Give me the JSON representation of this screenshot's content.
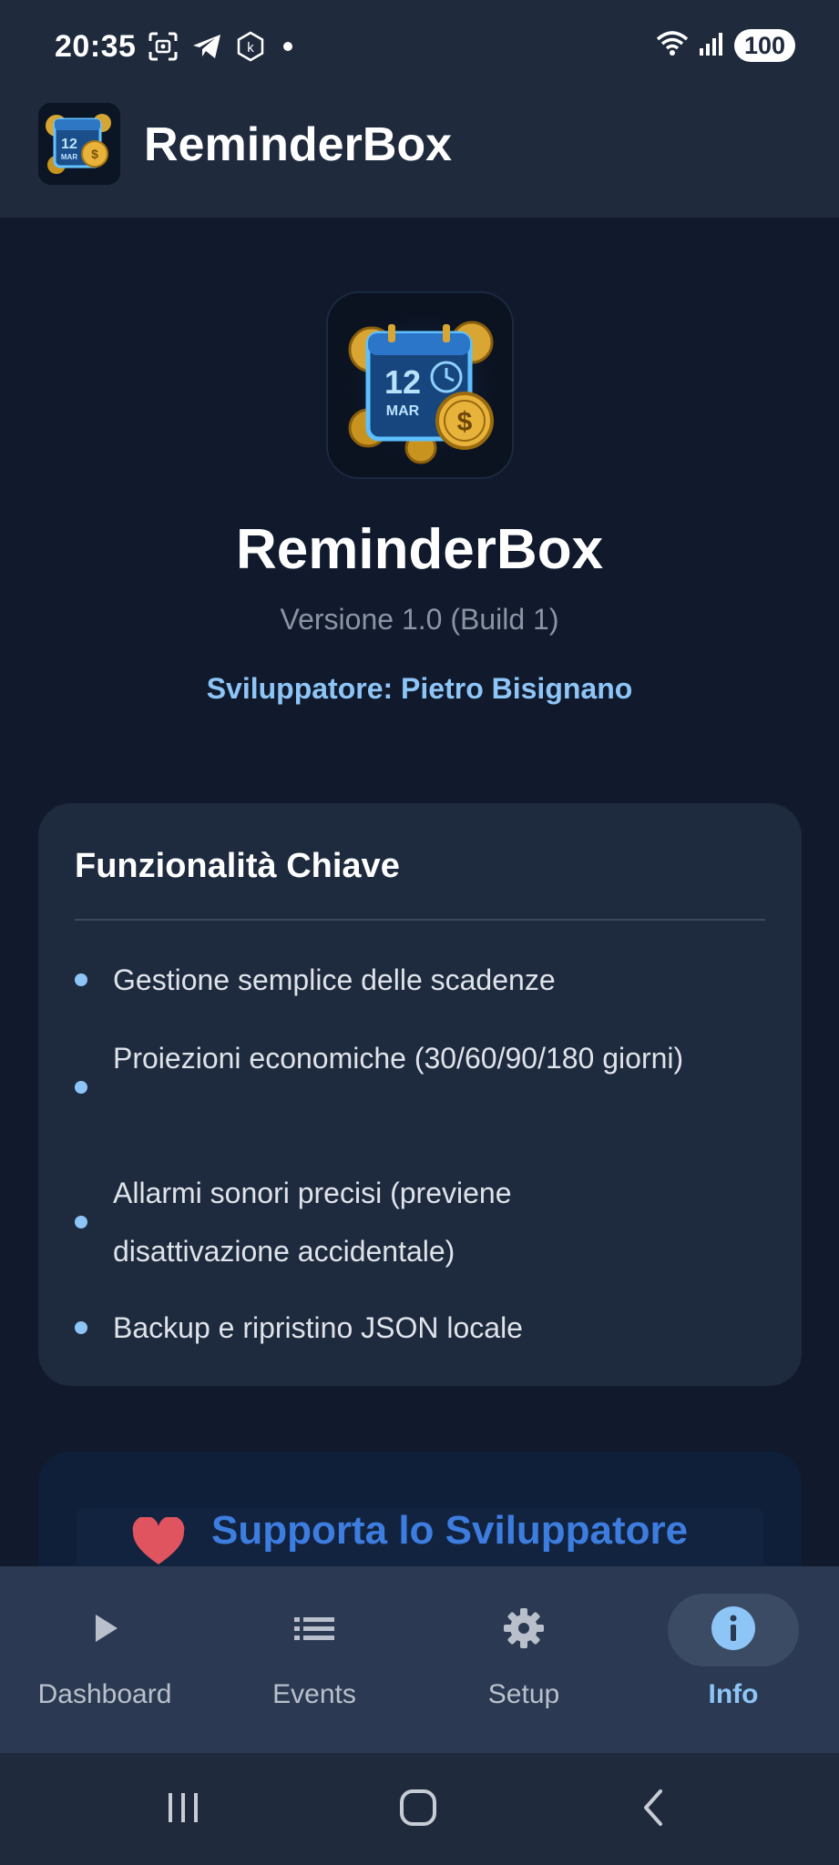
{
  "status_bar": {
    "time": "20:35",
    "battery": "100",
    "icons": [
      "screenshot-icon",
      "telegram-icon",
      "k-app-icon",
      "dot-icon",
      "wifi-icon",
      "signal-icon",
      "battery-icon"
    ]
  },
  "header": {
    "title": "ReminderBox",
    "logo": "app-logo-icon"
  },
  "hero": {
    "app_name": "ReminderBox",
    "version": "Versione 1.0 (Build 1)",
    "developer": "Sviluppatore: Pietro Bisignano"
  },
  "features": {
    "title": "Funzionalità Chiave",
    "items": [
      {
        "label": "Gestione semplice delle scadenze"
      },
      {
        "label": "Proiezioni economiche (30/60/90/180 giorni)"
      },
      {
        "label": "Allarmi sonori precisi (previene disattivazione accidentale)"
      },
      {
        "label": "Backup e ripristino JSON locale"
      }
    ]
  },
  "support": {
    "label": "Supporta lo Sviluppatore",
    "icon": "heart-icon"
  },
  "bottom_nav": {
    "items": [
      {
        "label": "Dashboard",
        "icon": "play-icon",
        "active": false
      },
      {
        "label": "Events",
        "icon": "list-icon",
        "active": false
      },
      {
        "label": "Setup",
        "icon": "gear-icon",
        "active": false
      },
      {
        "label": "Info",
        "icon": "info-icon",
        "active": true
      }
    ]
  },
  "system_nav": {
    "buttons": [
      "recents-icon",
      "home-icon",
      "back-icon"
    ]
  },
  "colors": {
    "background": "#101a2c",
    "surface": "#1e2a3d",
    "accent": "#8ec5f7",
    "nav_background": "#2b3a52"
  }
}
